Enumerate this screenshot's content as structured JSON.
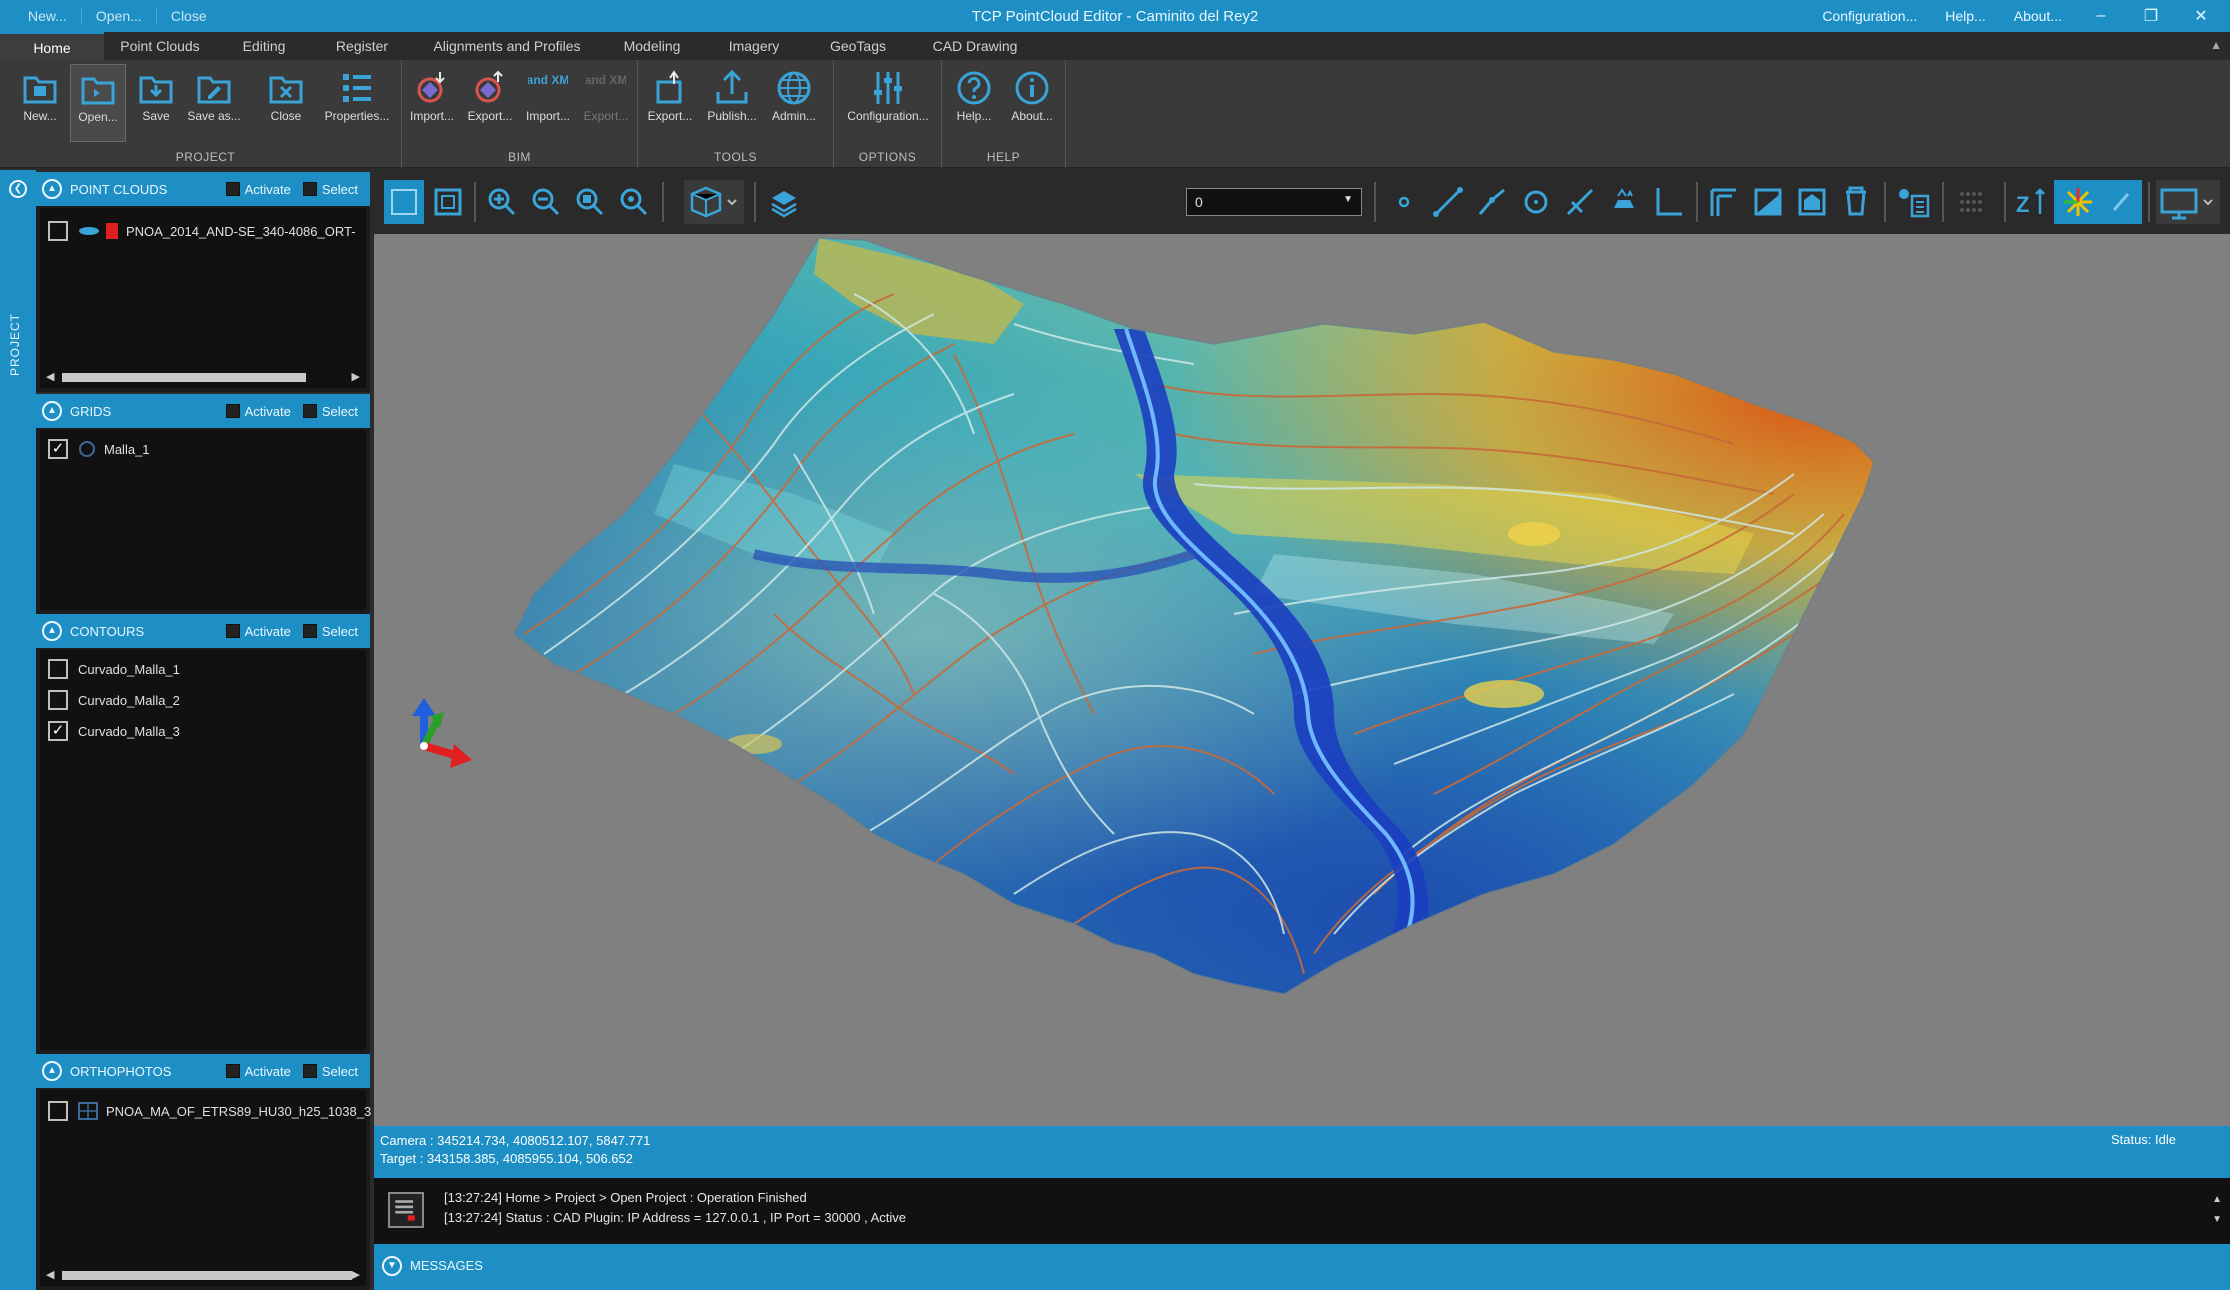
{
  "titlebar": {
    "quick_access": [
      "New...",
      "Open...",
      "Close"
    ],
    "title": "TCP PointCloud Editor - Caminito del Rey2",
    "right_links": [
      "Configuration...",
      "Help...",
      "About..."
    ],
    "minimize": "–",
    "restore": "❐",
    "close": "✕"
  },
  "ribbon_tabs": [
    "Home",
    "Point Clouds",
    "Editing",
    "Register",
    "Alignments and Profiles",
    "Modeling",
    "Imagery",
    "GeoTags",
    "CAD Drawing"
  ],
  "ribbon": {
    "groups": [
      {
        "name": "PROJECT",
        "buttons": [
          "New...",
          "Open...",
          "Save",
          "Save as...",
          "Close",
          "Properties..."
        ]
      },
      {
        "name": "BIM",
        "buttons": [
          "Import...",
          "Export...",
          "Import...",
          "Export..."
        ],
        "land_xml_label": "Land XML"
      },
      {
        "name": "TOOLS",
        "buttons": [
          "Export...",
          "Publish...",
          "Admin..."
        ]
      },
      {
        "name": "OPTIONS",
        "buttons": [
          "Configuration..."
        ]
      },
      {
        "name": "HELP",
        "buttons": [
          "Help...",
          "About..."
        ]
      }
    ]
  },
  "side_strip": {
    "label": "PROJECT"
  },
  "panels": {
    "header_options": {
      "activate": "Activate",
      "select": "Select"
    },
    "point_clouds": {
      "title": "POINT CLOUDS",
      "items": [
        {
          "label": "PNOA_2014_AND-SE_340-4086_ORT-",
          "checked": false
        }
      ]
    },
    "grids": {
      "title": "GRIDS",
      "items": [
        {
          "label": "Malla_1",
          "checked": true
        }
      ]
    },
    "contours": {
      "title": "CONTOURS",
      "items": [
        {
          "label": "Curvado_Malla_1",
          "checked": false
        },
        {
          "label": "Curvado_Malla_2",
          "checked": false
        },
        {
          "label": "Curvado_Malla_3",
          "checked": true
        }
      ]
    },
    "orthophotos": {
      "title": "ORTHOPHOTOS",
      "items": [
        {
          "label": "PNOA_MA_OF_ETRS89_HU30_h25_1038_3",
          "checked": false
        }
      ]
    }
  },
  "toolbar": {
    "layer_select_value": "0"
  },
  "status": {
    "camera": "Camera : 345214.734, 4080512.107, 5847.771",
    "target": "Target : 343158.385, 4085955.104, 506.652",
    "state": "Status: Idle"
  },
  "messages": {
    "title": "MESSAGES",
    "lines": [
      "[13:27:24] Home > Project > Open Project : Operation Finished",
      "[13:27:24] Status : CAD Plugin: IP Address = 127.0.0.1 , IP Port = 30000 , Active"
    ]
  },
  "colors": {
    "accent": "#1d8fc4",
    "panel_bg": "#1c1c1c",
    "viewport_bg": "#808080"
  }
}
